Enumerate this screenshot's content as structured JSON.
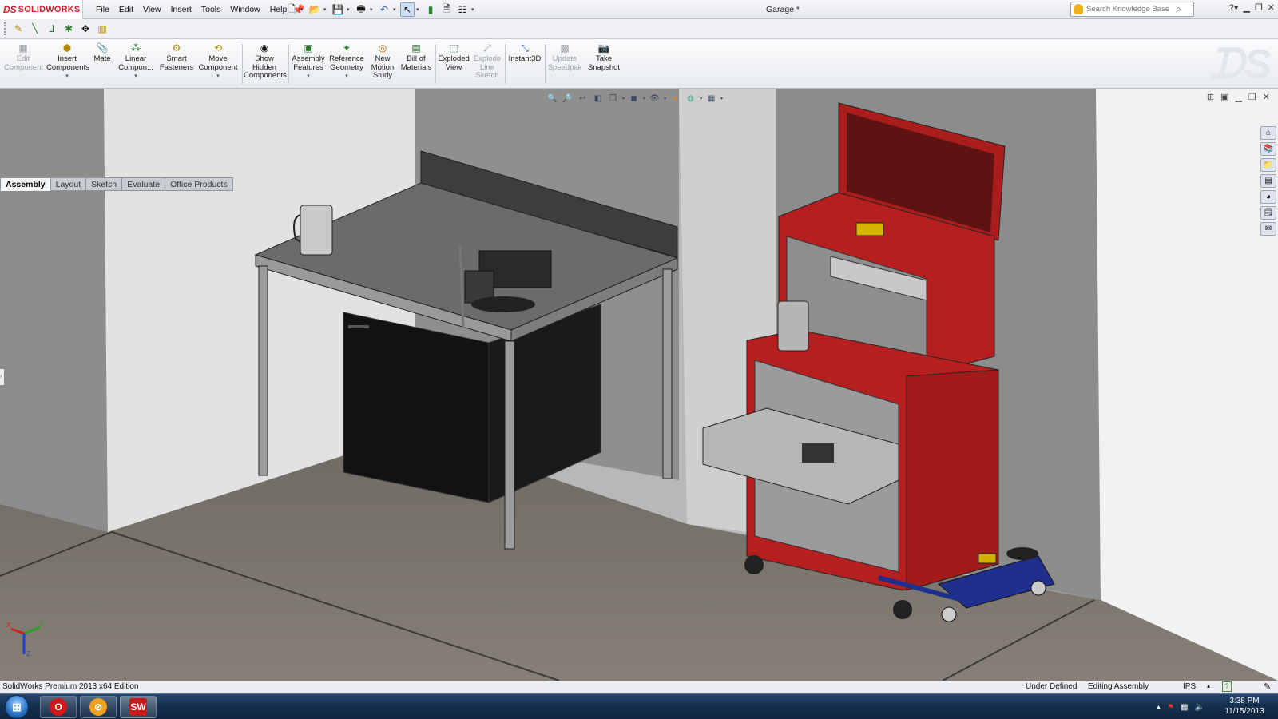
{
  "app": {
    "brand_ds": "DS",
    "brand_name": "SOLIDWORKS",
    "document_title": "Garage *"
  },
  "menu": [
    "File",
    "Edit",
    "View",
    "Insert",
    "Tools",
    "Window",
    "Help"
  ],
  "search": {
    "placeholder": "Search Knowledge Base"
  },
  "commands": {
    "edit_component": [
      "Edit",
      "Component"
    ],
    "insert_components": [
      "Insert",
      "Components"
    ],
    "mate": [
      "Mate"
    ],
    "linear_component": [
      "Linear",
      "Compon..."
    ],
    "smart_fasteners": [
      "Smart",
      "Fasteners"
    ],
    "move_component": [
      "Move",
      "Component"
    ],
    "show_hidden": [
      "Show",
      "Hidden",
      "Components"
    ],
    "assembly_features": [
      "Assembly",
      "Features"
    ],
    "reference_geometry": [
      "Reference",
      "Geometry"
    ],
    "new_motion_study": [
      "New",
      "Motion",
      "Study"
    ],
    "bill_of_materials": [
      "Bill of",
      "Materials"
    ],
    "exploded_view": [
      "Exploded",
      "View"
    ],
    "explode_line_sketch": [
      "Explode",
      "Line",
      "Sketch"
    ],
    "instant3d": [
      "Instant3D"
    ],
    "update_speedpak": [
      "Update",
      "Speedpak"
    ],
    "take_snapshot": [
      "Take",
      "Snapshot"
    ]
  },
  "tabs": [
    "Assembly",
    "Layout",
    "Sketch",
    "Evaluate",
    "Office Products"
  ],
  "active_tab": "Assembly",
  "status": {
    "edition": "SolidWorks Premium 2013 x64 Edition",
    "definition": "Under Defined",
    "mode": "Editing Assembly",
    "units": "IPS",
    "units_arrow": "▴",
    "help": "?"
  },
  "taskbar": {
    "start": "⊞",
    "apps": [
      "O",
      "⊘",
      "SW"
    ],
    "time": "3:38 PM",
    "date": "11/15/2013"
  },
  "triad_labels": {
    "x": "X",
    "y": "Y",
    "z": "Z"
  },
  "colors": {
    "toolbox_red": "#b51f1f",
    "jack_blue": "#1f2f8c",
    "floor": "#7b756c",
    "wall_light": "#e3e3e3",
    "wall_gray": "#8f8f8e",
    "brand_red": "#d11f26"
  }
}
